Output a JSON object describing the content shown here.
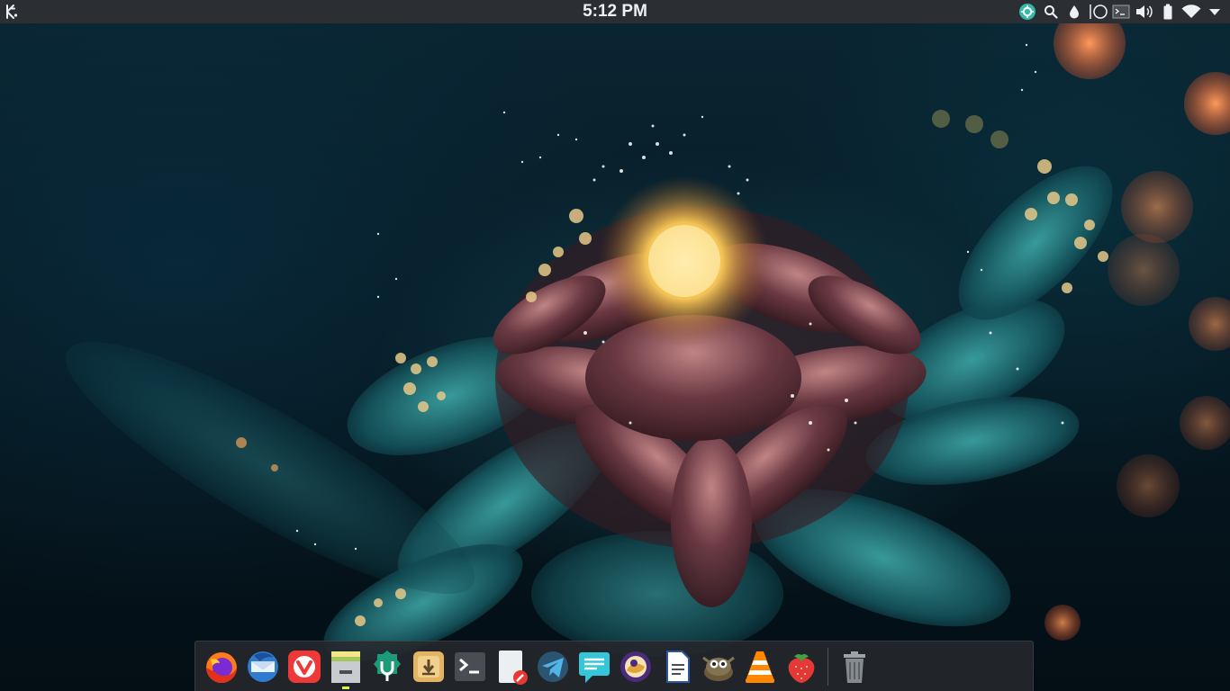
{
  "top_panel": {
    "clock": "5:12 PM",
    "tray_items": [
      {
        "icon": "opensuse-update-icon"
      },
      {
        "icon": "search-icon"
      },
      {
        "icon": "redshift-icon"
      },
      {
        "icon": "night-color-icon"
      },
      {
        "icon": "terminal-dropdown-icon"
      },
      {
        "icon": "volume-icon"
      },
      {
        "icon": "battery-icon"
      },
      {
        "icon": "wifi-icon"
      },
      {
        "icon": "expand-tray-icon"
      }
    ]
  },
  "dock": {
    "apps": [
      {
        "icon": "firefox-icon"
      },
      {
        "icon": "thunderbird-icon"
      },
      {
        "icon": "vivaldi-icon"
      },
      {
        "icon": "file-manager-icon",
        "running": true
      },
      {
        "icon": "discover-icon"
      },
      {
        "icon": "archive-manager-icon"
      },
      {
        "icon": "terminal-icon"
      },
      {
        "icon": "text-editor-icon"
      },
      {
        "icon": "telegram-icon"
      },
      {
        "icon": "chat-icon"
      },
      {
        "icon": "tor-browser-icon"
      },
      {
        "icon": "document-viewer-icon"
      },
      {
        "icon": "gimp-icon"
      },
      {
        "icon": "vlc-icon"
      },
      {
        "icon": "strawberry-icon"
      }
    ],
    "trash": {
      "icon": "trash-icon"
    }
  },
  "colors": {
    "panel": "#2b2e33",
    "dock": "#26282c",
    "running_indicator": "#d7f54a",
    "text": "#eef1f3"
  }
}
